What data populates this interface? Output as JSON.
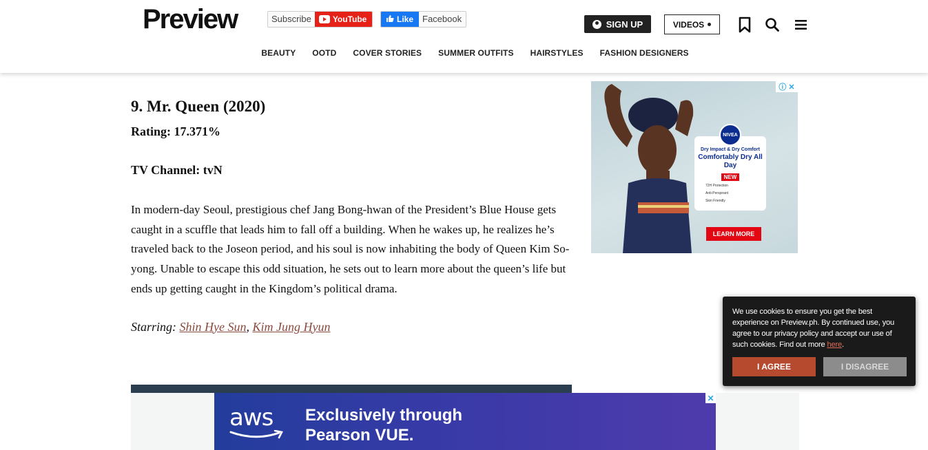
{
  "header": {
    "logo": "Preview",
    "subscribe_label": "Subscribe",
    "youtube_label": "YouTube",
    "like_label": "Like",
    "facebook_label": "Facebook",
    "signup_label": "SIGN UP",
    "videos_label": "VIDEOS",
    "icons": [
      "bookmark-icon",
      "search-icon",
      "menu-icon"
    ]
  },
  "nav": {
    "items": [
      "BEAUTY",
      "OOTD",
      "COVER STORIES",
      "SUMMER OUTFITS",
      "HAIRSTYLES",
      "FASHION DESIGNERS"
    ]
  },
  "article": {
    "title": "9. Mr. Queen (2020)",
    "rating": "Rating: 17.371%",
    "channel": "TV Channel: tvN",
    "body": "In modern-day Seoul, prestigious chef Jang Bong-hwan of the President’s Blue House gets caught in a scuffle that leads him to fall off a building. When he wakes up, he realizes he’s traveled back to the Joseon period, and his soul is now inhabiting the body of Queen Kim So-yong. Unable to escape this odd situation, he sets out to learn more about the queen’s life but ends up getting caught in the Kingdom’s political drama.",
    "starring_label": "Starring:",
    "starring_sep": ",",
    "cast": [
      "Shin Hye Sun",
      "Kim Jung Hyun"
    ]
  },
  "side_ad": {
    "brand": "NIVEA",
    "line1": "Dry Impact & Dry Comfort",
    "line2": "Comfortably Dry All Day",
    "new_badge": "NEW",
    "features": [
      "72H Protection",
      "Anti-Perspirant",
      "Skin Friendly"
    ],
    "cta": "LEARN MORE"
  },
  "cookie": {
    "text": "We use cookies to ensure you get the best experience on Preview.ph. By continued use, you agree to our privacy policy and accept our use of such cookies. Find out more",
    "link": "here",
    "agree": "I AGREE",
    "disagree": "I DISAGREE"
  },
  "bottom_ad": {
    "logo": "aws",
    "tagline_line1": "Exclusively through",
    "tagline_line2": "Pearson VUE."
  },
  "colors": {
    "accent_red": "#e62117",
    "facebook_blue": "#1877f2",
    "link_brown": "#8a4a3e",
    "cookie_agree": "#b54a2f"
  }
}
